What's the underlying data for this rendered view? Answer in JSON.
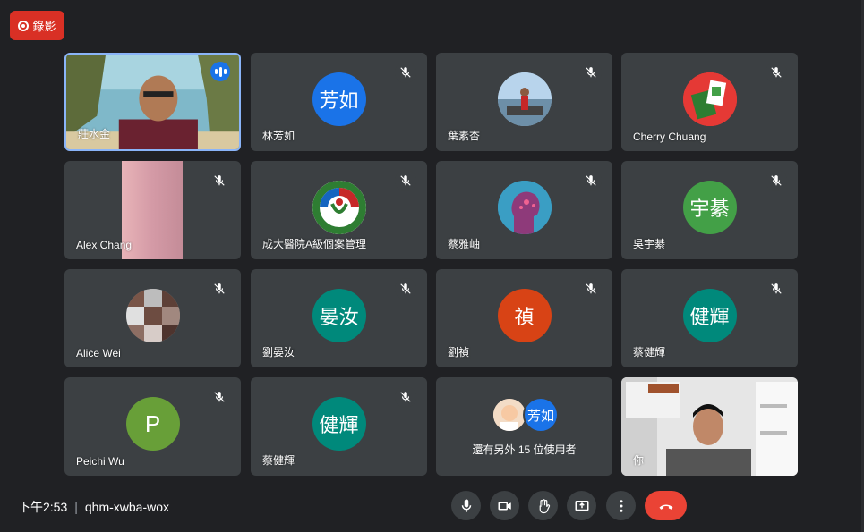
{
  "record": {
    "label": "錄影",
    "color": "#d93025"
  },
  "participants": [
    {
      "name": "莊水金",
      "type": "video",
      "speaking": true
    },
    {
      "name": "林芳如",
      "avatar_text": "芳如",
      "avatar_color": "#1a73e8",
      "muted": true
    },
    {
      "name": "葉素杏",
      "type": "photo",
      "muted": true
    },
    {
      "name": "Cherry Chuang",
      "type": "photo",
      "muted": true
    },
    {
      "name": "Alex Chang",
      "type": "video",
      "muted": true
    },
    {
      "name": "成大醫院A級個案管理",
      "type": "logo",
      "muted": true
    },
    {
      "name": "蔡雅岫",
      "type": "photo",
      "muted": true
    },
    {
      "name": "吳宇綦",
      "avatar_text": "宇綦",
      "avatar_color": "#43a047",
      "muted": true
    },
    {
      "name": "Alice Wei",
      "type": "photo",
      "muted": true
    },
    {
      "name": "劉晏汝",
      "avatar_text": "晏汝",
      "avatar_color": "#00897b",
      "muted": true
    },
    {
      "name": "劉禎",
      "avatar_text": "禎",
      "avatar_color": "#d84315",
      "muted": true
    },
    {
      "name": "蔡健輝",
      "avatar_text": "健輝",
      "avatar_color": "#00897b",
      "muted": true
    },
    {
      "name": "Peichi Wu",
      "avatar_text": "P",
      "avatar_color": "#689f38",
      "muted": true
    },
    {
      "name": "蔡健輝",
      "avatar_text": "健輝",
      "avatar_color": "#00897b",
      "muted": true
    },
    {
      "name": "還有另外 15 位使用者",
      "type": "more",
      "avatar_text": "芳如",
      "avatar_color": "#1a73e8"
    },
    {
      "name": "你",
      "type": "video"
    }
  ],
  "meeting": {
    "time": "下午2:53",
    "separator": "|",
    "code": "qhm-xwba-wox"
  },
  "controls": [
    "microphone-icon",
    "camera-icon",
    "raise-hand-icon",
    "present-screen-icon",
    "more-options-icon",
    "end-call-icon"
  ],
  "colors": {
    "background": "#202124",
    "tile": "#3c4043",
    "end_call": "#ea4335",
    "speaking_border": "#8ab4f8"
  }
}
